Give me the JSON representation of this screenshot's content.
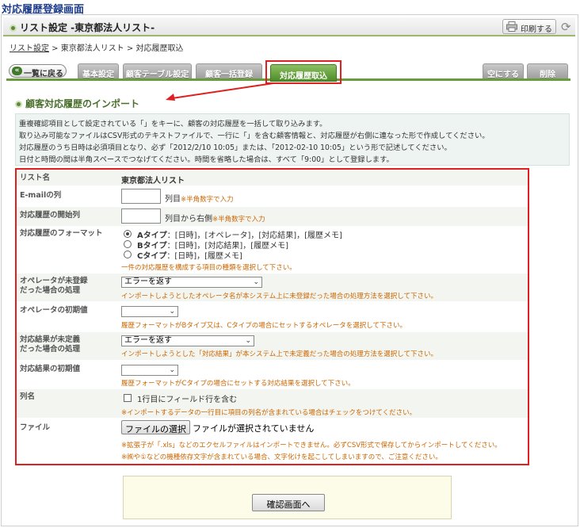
{
  "page_title": "対応履歴登録画面",
  "header": {
    "title": "リスト設定 -東京都法人リスト-",
    "print_label": "印刷する"
  },
  "breadcrumb": {
    "link": "リスト設定",
    "rest": " > 東京都法人リスト > 対応履歴取込"
  },
  "tabs": {
    "back": "一覧に戻る",
    "basic": "基本設定",
    "customer_table": "顧客テーブル設定",
    "bulk_register": "顧客一括登録",
    "history_import": "対応履歴取込",
    "clear": "空にする",
    "delete": "削除"
  },
  "section_title": "顧客対応履歴のインポート",
  "info_lines": [
    "重複確認項目として設定されている「」をキーに、顧客の対応履歴を一括して取り込みます。",
    "取り込み可能なファイルはCSV形式のテキストファイルで、一行に「」を含む顧客情報と、対応履歴が右側に連なった形で作成してください。",
    "対応履歴のうち日時は必須項目となり、必ず「2012/2/10 10:05」または、「2012-02-10 10:05」という形で記述してください。",
    "日付と時間の間は半角スペースでつなげてください。時間を省略した場合は、すべて「9:00」として登録します。"
  ],
  "form": {
    "list_name_label": "リスト名",
    "list_name_value": "東京都法人リスト",
    "email_label": "E-mailの列",
    "email_suffix": "列目",
    "email_note": "※半角数字で入力",
    "history_start_label": "対応履歴の開始列",
    "history_start_suffix": "列目から右側",
    "history_start_note": "※半角数字で入力",
    "format_label": "対応履歴のフォーマット",
    "format_a_name": "Aタイプ",
    "format_a_desc": "：[日時]，[オペレータ]，[対応結果]，[履歴メモ]",
    "format_b_name": "Bタイプ",
    "format_b_desc": "：[日時]，[対応結果]，[履歴メモ]",
    "format_c_name": "Cタイプ",
    "format_c_desc": "：[日時]，[履歴メモ]",
    "format_note": "一件の対応履歴を構成する項目の種類を選択して下さい。",
    "op_unreg_label_1": "オペレータが未登録",
    "op_unreg_label_2": "だった場合の処理",
    "op_unreg_value": "エラーを返す",
    "op_unreg_note": "インポートしようとしたオペレータ名が本システム上に未登録だった場合の処理方法を選択して下さい。",
    "op_default_label": "オペレータの初期値",
    "op_default_value": "",
    "op_default_note": "履歴フォーマットがBタイプ又は、Cタイプの場合にセットするオペレータを選択して下さい。",
    "result_undef_label_1": "対応結果が未定義",
    "result_undef_label_2": "だった場合の処理",
    "result_undef_value": "エラーを返す",
    "result_undef_note": "インポートしようとした「対応結果」が本システム上で未定義だった場合の処理方法を選択して下さい。",
    "result_default_label": "対応結果の初期値",
    "result_default_value": "",
    "result_default_note": "履歴フォーマットがCタイプの場合にセットする対応結果を選択して下さい。",
    "colname_label": "列名",
    "colname_check": "1行目にフィールド行を含む",
    "colname_note": "※インポートするデータの一行目に項目の列名が含まれている場合はチェックをつけてください。",
    "file_label": "ファイル",
    "file_button": "ファイルの選択",
    "file_status": "ファイルが選択されていません",
    "file_note_1": "※拡張子が「.xls」などのエクセルファイルはインポートできません。必ずCSV形式で保存してからインポートしてください。",
    "file_note_2": "※㈱や①などの機種依存文字が含まれている場合、文字化けを起こしてしまいますので、ご注意ください。"
  },
  "confirm_label": "確認画面へ",
  "colors": {
    "accent_green": "#4e8c28",
    "highlight_red": "#e02020",
    "note_orange": "#cc6600"
  }
}
